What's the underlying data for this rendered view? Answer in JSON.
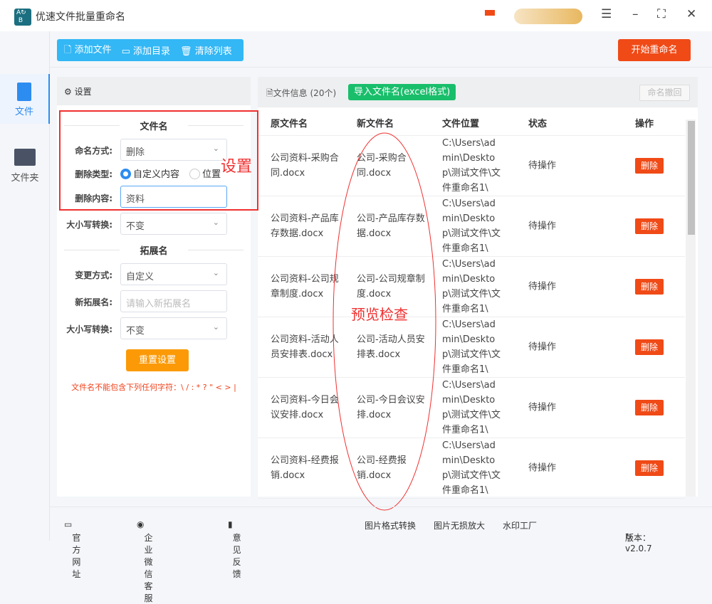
{
  "app": {
    "title": "优速文件批量重命名",
    "logo": "AB"
  },
  "toolbar": {
    "add_file": "添加文件",
    "add_dir": "添加目录",
    "clear": "清除列表",
    "start": "开始重命名"
  },
  "sidebar": [
    {
      "label": "文件"
    },
    {
      "label": "文件夹"
    }
  ],
  "settings": {
    "title": "设置",
    "filename_section": "文件名",
    "naming_label": "命名方式:",
    "naming_value": "删除",
    "delete_type_label": "删除类型:",
    "delete_type_options": [
      "自定义内容",
      "位置"
    ],
    "delete_content_label": "删除内容:",
    "delete_content_value": "资料",
    "case_label": "大小写转换:",
    "case_value": "不变",
    "ext_section": "拓展名",
    "change_label": "变更方式:",
    "change_value": "自定义",
    "new_ext_label": "新拓展名:",
    "new_ext_placeholder": "请输入新拓展名",
    "ext_case_label": "大小写转换:",
    "ext_case_value": "不变",
    "reset": "重置设置",
    "warning": "文件名不能包含下列任何字符：\\ / : * ? \" < > |"
  },
  "files": {
    "title": "文件信息",
    "count": "(20个)",
    "import": "导入文件名(excel格式)",
    "undo": "命名撤回",
    "columns": [
      "原文件名",
      "新文件名",
      "文件位置",
      "状态",
      "操作"
    ],
    "rows": [
      {
        "orig": "公司资料-采购合同.docx",
        "new": "公司-采购合同.docx",
        "path": "C:\\Users\\admin\\Desktop\\测试文件\\文件重命名1\\",
        "status": "待操作",
        "action": "删除"
      },
      {
        "orig": "公司资料-产品库存数据.docx",
        "new": "公司-产品库存数据.docx",
        "path": "C:\\Users\\admin\\Desktop\\测试文件\\文件重命名1\\",
        "status": "待操作",
        "action": "删除"
      },
      {
        "orig": "公司资料-公司规章制度.docx",
        "new": "公司-公司规章制度.docx",
        "path": "C:\\Users\\admin\\Desktop\\测试文件\\文件重命名1\\",
        "status": "待操作",
        "action": "删除"
      },
      {
        "orig": "公司资料-活动人员安排表.docx",
        "new": "公司-活动人员安排表.docx",
        "path": "C:\\Users\\admin\\Desktop\\测试文件\\文件重命名1\\",
        "status": "待操作",
        "action": "删除"
      },
      {
        "orig": "公司资料-今日会议安排.docx",
        "new": "公司-今日会议安排.docx",
        "path": "C:\\Users\\admin\\Desktop\\测试文件\\文件重命名1\\",
        "status": "待操作",
        "action": "删除"
      },
      {
        "orig": "公司资料-经费报销.docx",
        "new": "公司-经费报销.docx",
        "path": "C:\\Users\\admin\\Desktop\\测试文件\\文件重命名1\\",
        "status": "待操作",
        "action": "删除"
      }
    ]
  },
  "annotations": {
    "settings": "设置",
    "preview": "预览检查"
  },
  "footer": {
    "website": "官方网址",
    "wechat": "企业微信客服",
    "feedback": "意见反馈",
    "img_convert": "图片格式转换",
    "img_enlarge": "图片无损放大",
    "watermark": "水印工厂",
    "version": "版本：v2.0.7"
  }
}
